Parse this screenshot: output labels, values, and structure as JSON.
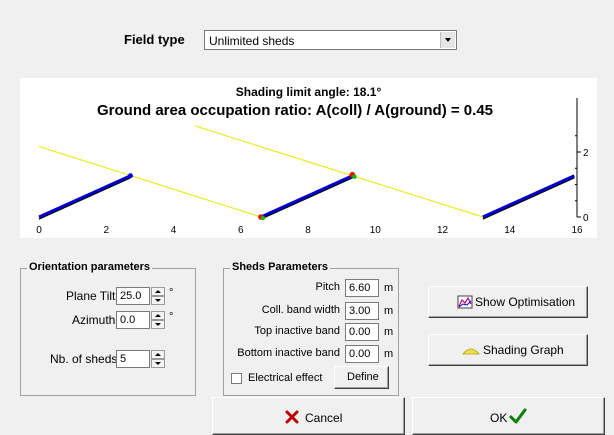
{
  "field_type": {
    "label": "Field type",
    "value": "Unlimited sheds"
  },
  "chart": {
    "line1": "Shading limit angle:  18.1°",
    "line2": "Ground area occupation ratio:  A(coll) / A(ground) = 0.45"
  },
  "chart_data": {
    "type": "line",
    "x_ticks": [
      "0",
      "2",
      "4",
      "6",
      "8",
      "10",
      "12",
      "14",
      "16"
    ],
    "y_ticks": [
      "0",
      "2"
    ],
    "xlim": [
      0,
      16
    ],
    "ylim": [
      0,
      2.8
    ],
    "sheds": [
      {
        "x": [
          0.0,
          2.72
        ],
        "y": [
          0.0,
          1.27
        ]
      },
      {
        "x": [
          6.6,
          9.32
        ],
        "y": [
          0.0,
          1.27
        ]
      },
      {
        "x": [
          13.2,
          15.92
        ],
        "y": [
          0.0,
          1.27
        ]
      }
    ],
    "shading_rays": [
      {
        "x": [
          0.0,
          6.6
        ],
        "y": [
          2.17,
          0.0
        ]
      },
      {
        "x": [
          4.65,
          13.2
        ],
        "y": [
          2.8,
          0.0
        ]
      }
    ],
    "colors": {
      "shed": "#0000cc",
      "ray": "#e8e800",
      "marker_top": "#0000ff",
      "marker_red": "#ff0000",
      "marker_green": "#00c000"
    }
  },
  "orientation": {
    "title": "Orientation parameters",
    "plane_tilt_label": "Plane Tilt",
    "plane_tilt_value": "25.0",
    "azimuth_label": "Azimuth",
    "azimuth_value": "0.0",
    "deg_unit": "°",
    "nb_sheds_label": "Nb. of sheds",
    "nb_sheds_value": "5"
  },
  "sheds": {
    "title": "Sheds Parameters",
    "pitch_label": "Pitch",
    "pitch_value": "6.60",
    "band_label": "Coll. band width",
    "band_value": "3.00",
    "top_label": "Top inactive band",
    "top_value": "0.00",
    "bottom_label": "Bottom inactive band",
    "bottom_value": "0.00",
    "unit": "m",
    "electrical_label": "Electrical effect",
    "define_label": "Define"
  },
  "buttons": {
    "show_optimisation": "Show Optimisation",
    "shading_graph": "Shading Graph",
    "cancel": "Cancel",
    "ok": "OK"
  }
}
